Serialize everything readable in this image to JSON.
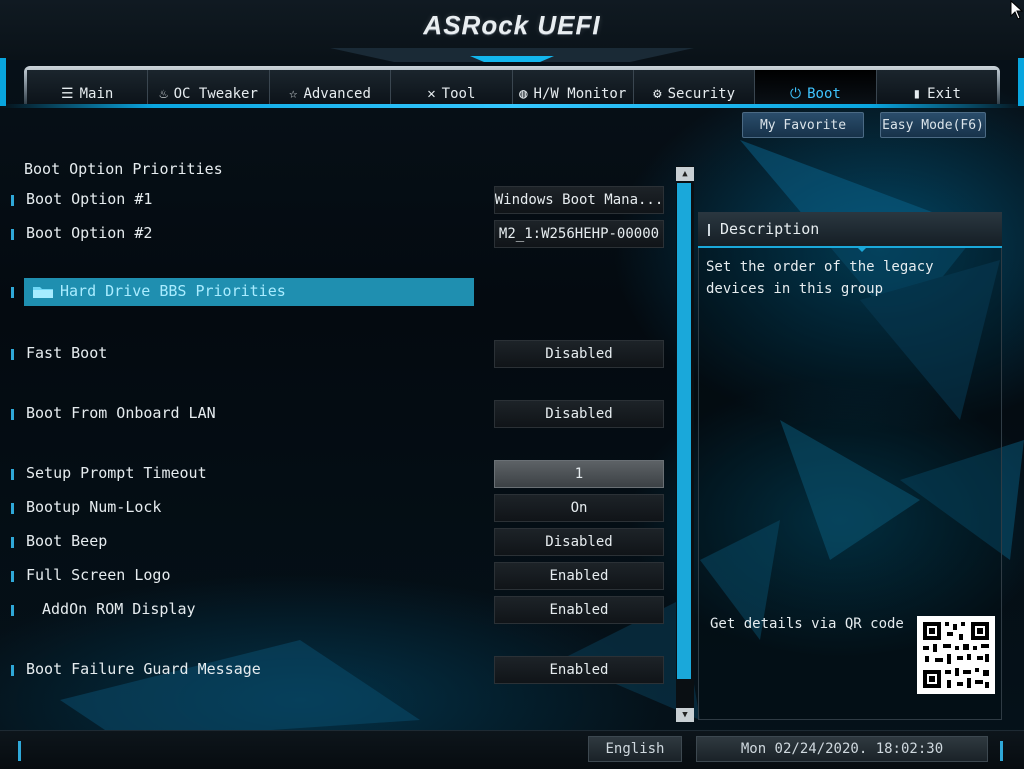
{
  "header": {
    "logo": "ASRock UEFI"
  },
  "tabs": [
    {
      "label": "Main",
      "icon": "list-icon",
      "glyph": "☰",
      "active": false
    },
    {
      "label": "OC Tweaker",
      "icon": "flame-icon",
      "glyph": "♨",
      "active": false
    },
    {
      "label": "Advanced",
      "icon": "star-icon",
      "glyph": "☆",
      "active": false
    },
    {
      "label": "Tool",
      "icon": "wrench-icon",
      "glyph": "✕",
      "active": false
    },
    {
      "label": "H/W Monitor",
      "icon": "monitor-icon",
      "glyph": "◍",
      "active": false
    },
    {
      "label": "Security",
      "icon": "shield-icon",
      "glyph": "⚙",
      "active": false
    },
    {
      "label": "Boot",
      "icon": "power-icon",
      "glyph": "⏻",
      "active": true
    },
    {
      "label": "Exit",
      "icon": "exit-icon",
      "glyph": "▮",
      "active": false
    }
  ],
  "toolbar": {
    "favorite": "My Favorite",
    "easy_mode": "Easy Mode(F6)"
  },
  "section_title": "Boot Option Priorities",
  "rows": [
    {
      "label": "Boot Option #1",
      "value": "Windows Boot Mana..."
    },
    {
      "label": "Boot Option #2",
      "value": "M2_1:W256HEHP-00000"
    }
  ],
  "hard_drive": "Hard Drive BBS Priorities",
  "settings": [
    {
      "label": "Fast Boot",
      "value": "Disabled"
    },
    {
      "label": "Boot From Onboard LAN",
      "value": "Disabled"
    },
    {
      "label": "Setup Prompt Timeout",
      "value": "1"
    },
    {
      "label": "Bootup Num-Lock",
      "value": "On"
    },
    {
      "label": "Boot Beep",
      "value": "Disabled"
    },
    {
      "label": "Full Screen Logo",
      "value": "Enabled"
    },
    {
      "label": "AddOn ROM Display",
      "value": "Enabled"
    },
    {
      "label": "Boot Failure Guard Message",
      "value": "Enabled"
    }
  ],
  "description": {
    "title": "Description",
    "text": "Set the order of the legacy devices in this group",
    "qr_label": "Get details via QR code"
  },
  "footer": {
    "language": "English",
    "datetime": "Mon 02/24/2020. 18:02:30"
  },
  "colors": {
    "accent": "#1aa8da",
    "highlight": "#1f8fb0",
    "active_tab_text": "#3fc4ff"
  }
}
